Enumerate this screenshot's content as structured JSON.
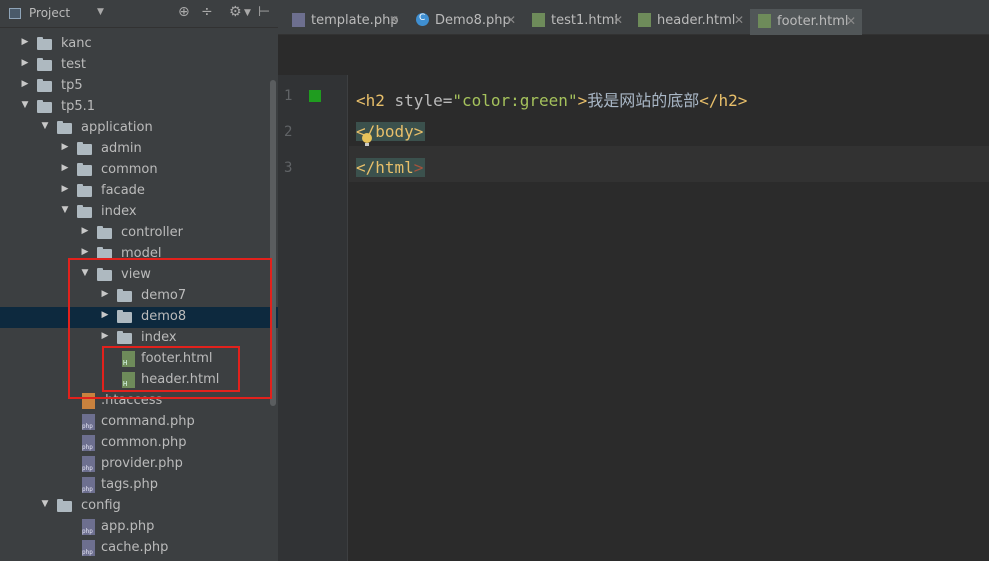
{
  "project_panel": {
    "title": "Project",
    "tree": [
      {
        "label": "kanc",
        "type": "folder",
        "depth": 0,
        "expanded": false
      },
      {
        "label": "test",
        "type": "folder",
        "depth": 0,
        "expanded": false
      },
      {
        "label": "tp5",
        "type": "folder",
        "depth": 0,
        "expanded": false
      },
      {
        "label": "tp5.1",
        "type": "folder",
        "depth": 0,
        "expanded": true
      },
      {
        "label": "application",
        "type": "folder",
        "depth": 1,
        "expanded": true
      },
      {
        "label": "admin",
        "type": "folder",
        "depth": 2,
        "expanded": false
      },
      {
        "label": "common",
        "type": "folder",
        "depth": 2,
        "expanded": false
      },
      {
        "label": "facade",
        "type": "folder",
        "depth": 2,
        "expanded": false
      },
      {
        "label": "index",
        "type": "folder",
        "depth": 2,
        "expanded": true
      },
      {
        "label": "controller",
        "type": "folder",
        "depth": 3,
        "expanded": false
      },
      {
        "label": "model",
        "type": "folder",
        "depth": 3,
        "expanded": false
      },
      {
        "label": "view",
        "type": "folder",
        "depth": 3,
        "expanded": true
      },
      {
        "label": "demo7",
        "type": "folder",
        "depth": 4,
        "expanded": false
      },
      {
        "label": "demo8",
        "type": "folder",
        "depth": 4,
        "expanded": false,
        "selected": true
      },
      {
        "label": "index",
        "type": "folder",
        "depth": 4,
        "expanded": false
      },
      {
        "label": "footer.html",
        "type": "html",
        "depth": 4
      },
      {
        "label": "header.html",
        "type": "html",
        "depth": 4
      },
      {
        "label": ".htaccess",
        "type": "htaccess",
        "depth": 2
      },
      {
        "label": "command.php",
        "type": "php",
        "depth": 2
      },
      {
        "label": "common.php",
        "type": "php",
        "depth": 2
      },
      {
        "label": "provider.php",
        "type": "php",
        "depth": 2
      },
      {
        "label": "tags.php",
        "type": "php",
        "depth": 2
      },
      {
        "label": "config",
        "type": "folder",
        "depth": 1,
        "expanded": true
      },
      {
        "label": "app.php",
        "type": "php",
        "depth": 2
      },
      {
        "label": "cache.php",
        "type": "php",
        "depth": 2
      }
    ]
  },
  "tabs": [
    {
      "label": "template.php",
      "icon": "php",
      "active": false
    },
    {
      "label": "Demo8.php",
      "icon": "class",
      "active": false
    },
    {
      "label": "test1.html",
      "icon": "html",
      "active": false
    },
    {
      "label": "header.html",
      "icon": "html",
      "active": false
    },
    {
      "label": "footer.html",
      "icon": "html",
      "active": true
    }
  ],
  "editor": {
    "line_numbers": [
      "1",
      "2",
      "3"
    ],
    "line1": {
      "open": "<h2",
      "attr": " style=",
      "str": "\"color:green\"",
      "close": ">",
      "text": "我是网站的底部",
      "end": "</h2>"
    },
    "line2": {
      "lt": "<",
      "rest": "/body>"
    },
    "line3": {
      "lt": "</html",
      "gt": ">"
    }
  },
  "colors": {
    "tag": "#e8bf6a",
    "string": "#a5c25c",
    "highlight_box": "#e2211c"
  }
}
